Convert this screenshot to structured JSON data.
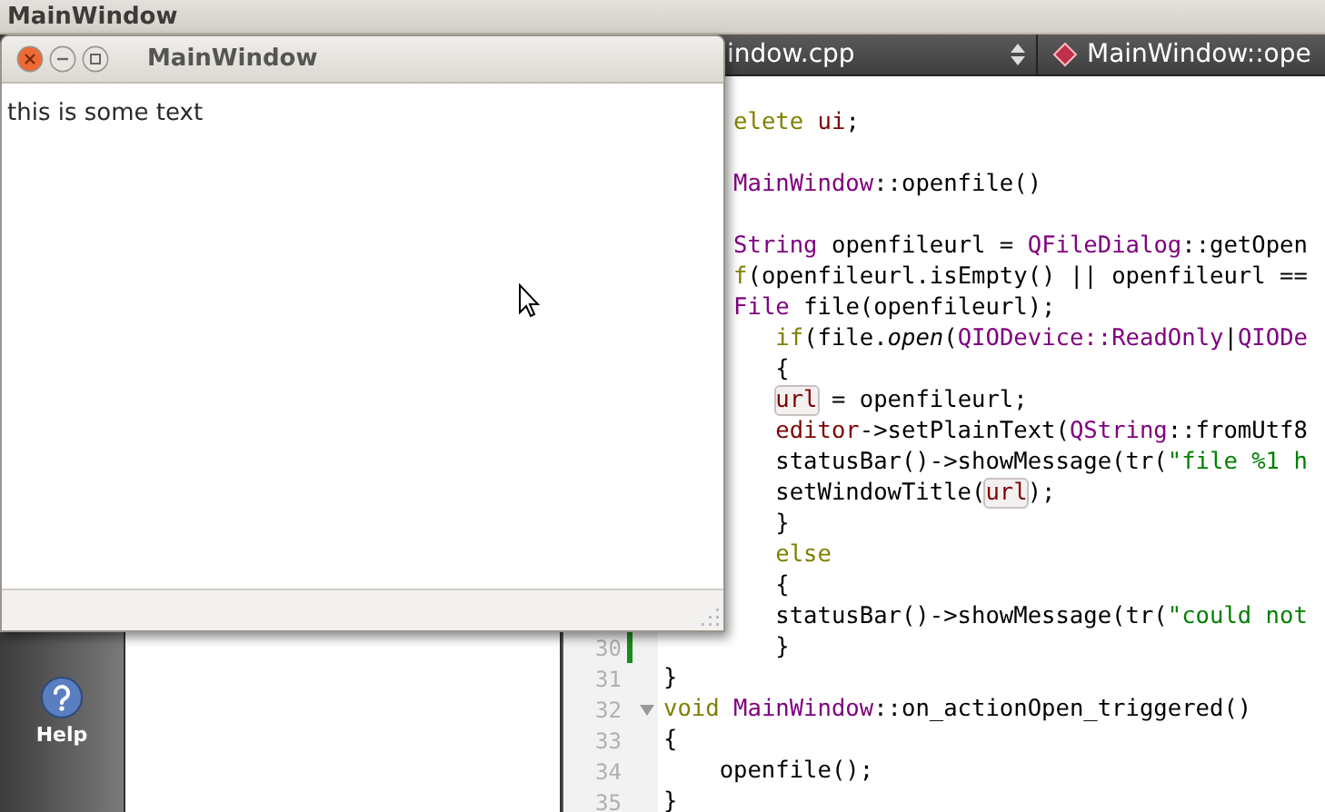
{
  "screen_title": "MainWindow",
  "editor": {
    "file_name": "indow.cpp",
    "symbol": "MainWindow::ope",
    "lines": [
      {
        "kind": "cut",
        "segments": [
          {
            "kind": "keyword",
            "text": " elete"
          },
          {
            "kind": "member",
            "text": " ui"
          },
          {
            "kind": "plain",
            "text": ";"
          }
        ]
      },
      {
        "kind": "blank"
      },
      {
        "kind": "cut",
        "segments": [
          {
            "kind": "type",
            "text": " MainWindow"
          },
          {
            "kind": "plain",
            "text": "::openfile()"
          }
        ]
      },
      {
        "kind": "blank"
      },
      {
        "kind": "cut",
        "segments": [
          {
            "kind": "type",
            "text": " String"
          },
          {
            "kind": "plain",
            "text": " openfileurl = "
          },
          {
            "kind": "type",
            "text": "QFileDialog"
          },
          {
            "kind": "plain",
            "text": "::getOpen"
          }
        ]
      },
      {
        "kind": "cut",
        "segments": [
          {
            "kind": "keyword",
            "text": " f"
          },
          {
            "kind": "plain",
            "text": "(openfileurl.isEmpty() || openfileurl =="
          }
        ]
      },
      {
        "kind": "cut",
        "segments": [
          {
            "kind": "type",
            "text": " File"
          },
          {
            "kind": "plain",
            "text": " file(openfileurl);"
          }
        ]
      },
      {
        "kind": "cut",
        "segments": [
          {
            "kind": "keyword",
            "text": "    if"
          },
          {
            "kind": "plain",
            "text": "(file."
          },
          {
            "kind": "italic",
            "text": "open"
          },
          {
            "kind": "plain",
            "text": "("
          },
          {
            "kind": "type",
            "text": "QIODevice::ReadOnly"
          },
          {
            "kind": "plain",
            "text": "|"
          },
          {
            "kind": "type",
            "text": "QIODe"
          }
        ]
      },
      {
        "kind": "cut",
        "segments": [
          {
            "kind": "plain",
            "text": "    {"
          }
        ]
      },
      {
        "kind": "cut",
        "segments": [
          {
            "kind": "ref",
            "text": "    url"
          },
          {
            "kind": "plain",
            "text": " = openfileurl;"
          }
        ]
      },
      {
        "kind": "cut",
        "segments": [
          {
            "kind": "member",
            "text": "    editor"
          },
          {
            "kind": "plain",
            "text": "->setPlainText("
          },
          {
            "kind": "type",
            "text": "QString"
          },
          {
            "kind": "plain",
            "text": "::fromUtf8"
          }
        ]
      },
      {
        "kind": "cut",
        "segments": [
          {
            "kind": "plain",
            "text": "    statusBar()->showMessage(tr("
          },
          {
            "kind": "string",
            "text": "\"file %1 h"
          }
        ]
      },
      {
        "kind": "cut",
        "segments": [
          {
            "kind": "plain",
            "text": "    setWindowTitle("
          },
          {
            "kind": "ref",
            "text": "url"
          },
          {
            "kind": "plain",
            "text": ");"
          }
        ]
      },
      {
        "kind": "cut",
        "segments": [
          {
            "kind": "plain",
            "text": "    }"
          }
        ]
      },
      {
        "kind": "cut",
        "segments": [
          {
            "kind": "keyword",
            "text": "    else"
          }
        ]
      },
      {
        "kind": "cut",
        "segments": [
          {
            "kind": "plain",
            "text": "    {"
          }
        ]
      },
      {
        "kind": "cut",
        "segments": [
          {
            "kind": "plain",
            "text": "    statusBar()->showMessage(tr("
          },
          {
            "kind": "string",
            "text": "\"could not"
          }
        ]
      },
      {
        "kind": "code",
        "number": "30",
        "modified": true,
        "foldable": false,
        "segments": [
          {
            "kind": "plain",
            "text": "        }"
          }
        ]
      },
      {
        "kind": "code",
        "number": "31",
        "modified": false,
        "foldable": false,
        "segments": [
          {
            "kind": "plain",
            "text": "}"
          }
        ]
      },
      {
        "kind": "code",
        "number": "32",
        "modified": false,
        "foldable": true,
        "segments": [
          {
            "kind": "keyword",
            "text": "void"
          },
          {
            "kind": "type",
            "text": " MainWindow"
          },
          {
            "kind": "plain",
            "text": "::on_actionOpen_triggered()"
          }
        ]
      },
      {
        "kind": "code",
        "number": "33",
        "modified": false,
        "foldable": false,
        "segments": [
          {
            "kind": "plain",
            "text": "{"
          }
        ]
      },
      {
        "kind": "code",
        "number": "34",
        "modified": false,
        "foldable": false,
        "segments": [
          {
            "kind": "plain",
            "text": "    openfile();"
          }
        ]
      },
      {
        "kind": "code",
        "number": "35",
        "modified": false,
        "foldable": false,
        "segments": [
          {
            "kind": "plain",
            "text": "}"
          }
        ]
      }
    ]
  },
  "mode_bar": {
    "items": [
      {
        "label": "Help"
      }
    ]
  },
  "app_window": {
    "title": "MainWindow",
    "text": "this is some text"
  }
}
